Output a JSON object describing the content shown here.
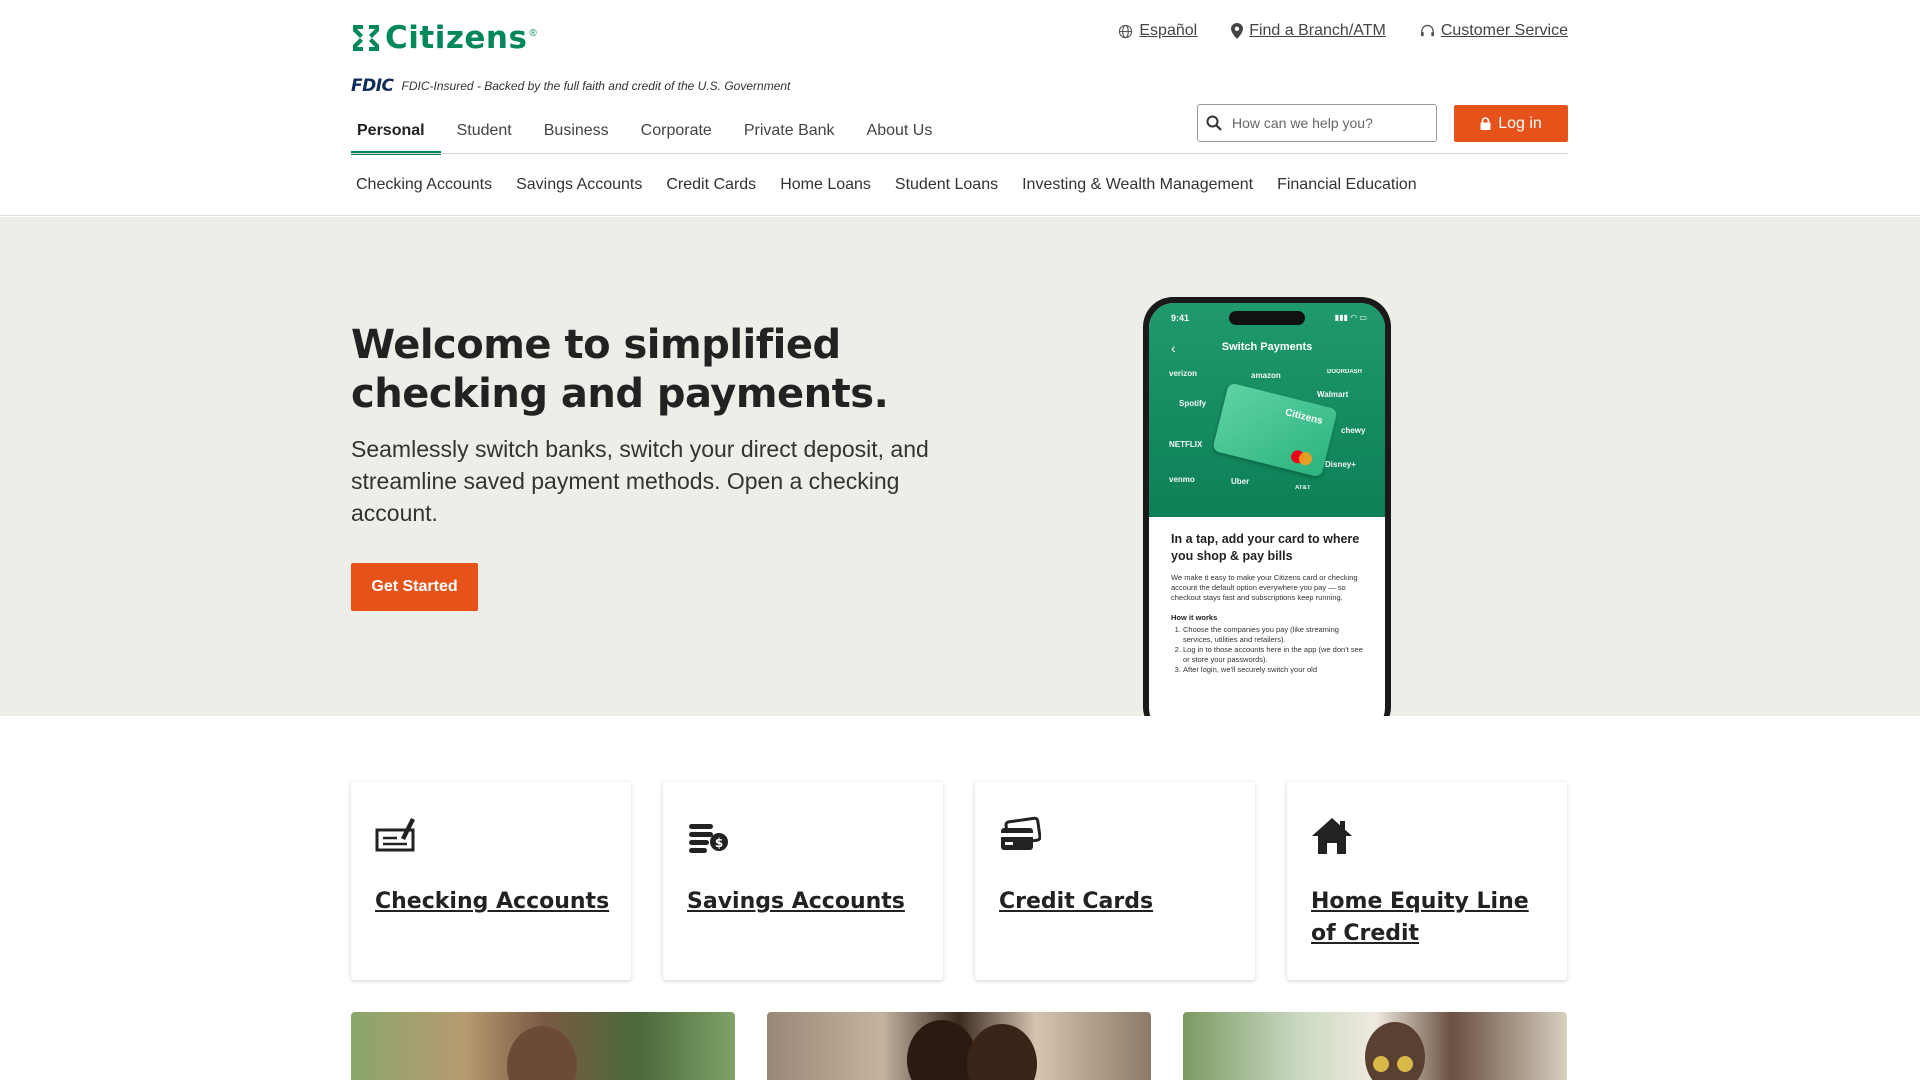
{
  "brand": {
    "name": "Citizens",
    "tm": "®",
    "color": "#00875a"
  },
  "utility": {
    "espanol": "Español",
    "branch": "Find a Branch/ATM",
    "service": "Customer Service"
  },
  "fdic": {
    "logo": "FDIC",
    "text": "FDIC-Insured - Backed by the full faith and credit of the U.S. Government"
  },
  "main_nav": [
    "Personal",
    "Student",
    "Business",
    "Corporate",
    "Private Bank",
    "About Us"
  ],
  "search": {
    "placeholder": "How can we help you?"
  },
  "login": {
    "label": "Log in"
  },
  "sub_nav": [
    "Checking Accounts",
    "Savings Accounts",
    "Credit Cards",
    "Home Loans",
    "Student Loans",
    "Investing & Wealth Management",
    "Financial Education"
  ],
  "hero": {
    "title": "Welcome to simplified checking and payments.",
    "body": "Seamlessly switch banks, switch your direct deposit, and streamline saved payment methods. Open a checking account.",
    "cta": "Get Started"
  },
  "phone": {
    "time": "9:41",
    "screen_title": "Switch Payments",
    "brands": [
      "verizon",
      "amazon",
      "DOORDASH",
      "Walmart",
      "Spotify",
      "chewy",
      "NETFLIX",
      "venmo",
      "Uber",
      "Disney+",
      "AT&T"
    ],
    "card_brand": "Citizens",
    "heading": "In a tap, add your card to where you shop & pay bills",
    "paragraph": "We make it easy to make your Citizens card or checking account the default option everywhere you pay — so checkout stays fast and subscriptions keep running.",
    "how": "How it works",
    "steps": [
      "Choose the companies you pay (like streaming services, utilities and retailers).",
      "Log in to those accounts here in the app (we don't see or store your passwords).",
      "After login, we'll securely switch your old"
    ]
  },
  "cards": [
    {
      "label": "Checking Accounts",
      "icon": "check-icon"
    },
    {
      "label": "Savings Accounts",
      "icon": "coins-dollar-icon"
    },
    {
      "label": "Credit Cards",
      "icon": "credit-card-icon"
    },
    {
      "label": "Home Equity Line of Credit",
      "icon": "house-icon"
    }
  ]
}
